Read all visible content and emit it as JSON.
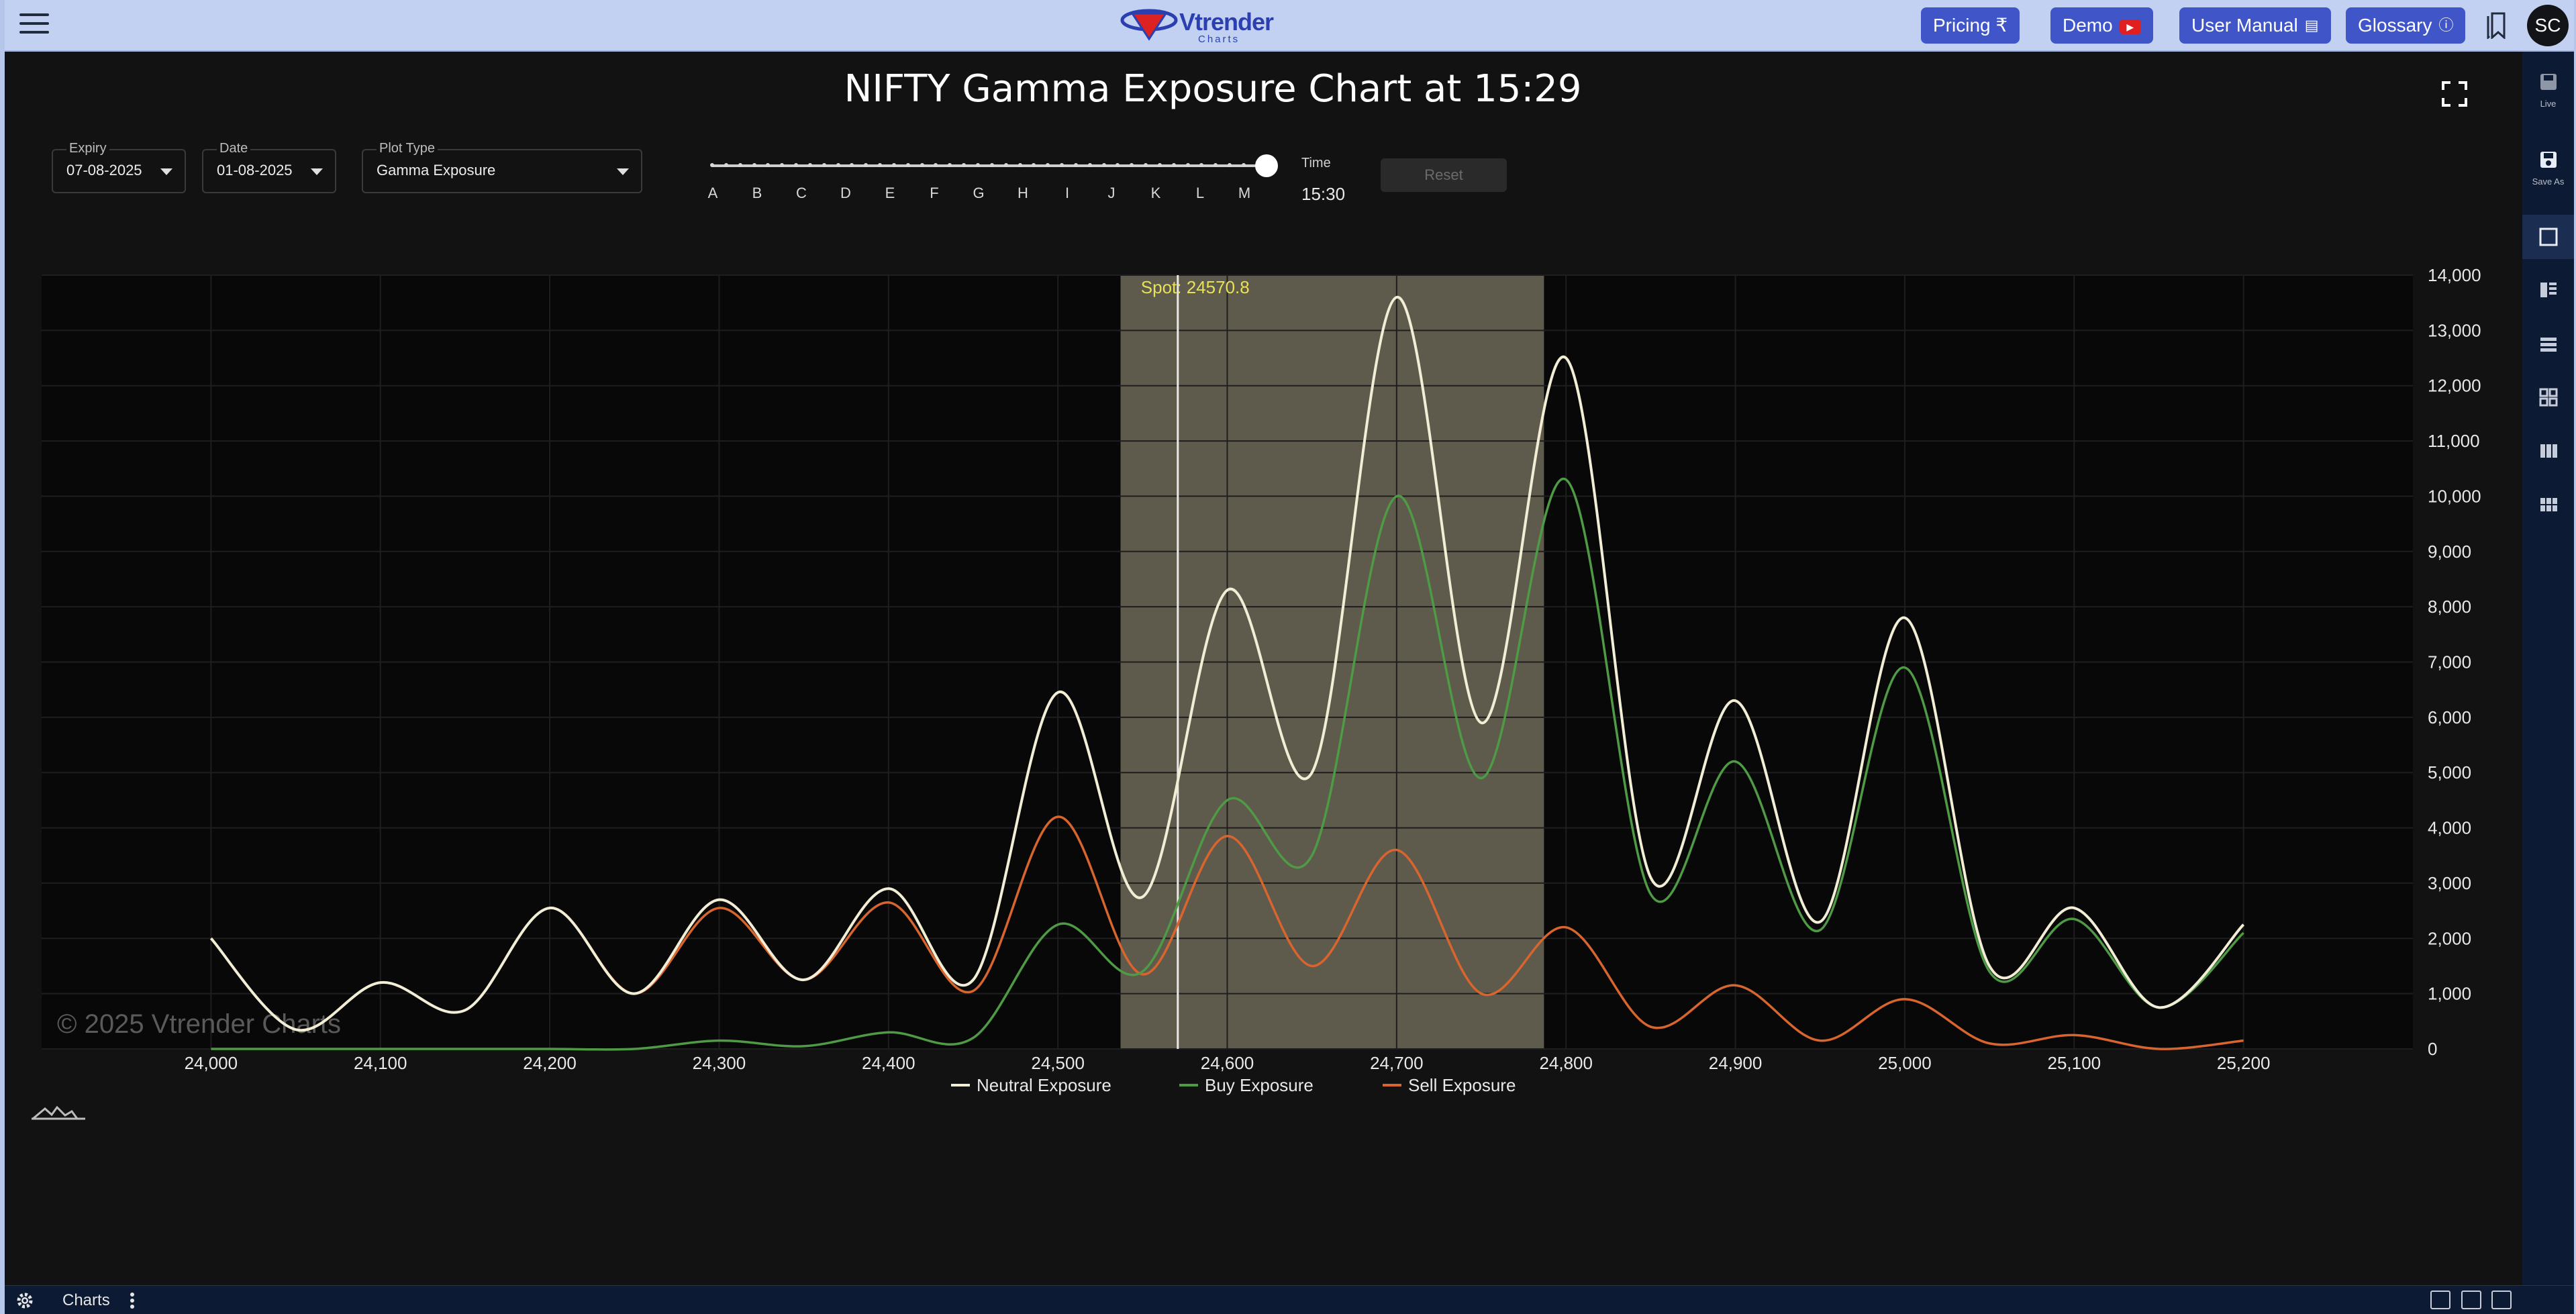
{
  "topbar": {
    "logo_text": "Vtrender",
    "logo_sub": "Charts",
    "pricing_label": "Pricing ₹",
    "demo_label": "Demo",
    "manual_label": "User Manual",
    "glossary_label": "Glossary",
    "avatar_initials": "SC"
  },
  "sidebar": {
    "live_label": "Live",
    "save_label": "Save As"
  },
  "controls": {
    "expiry_label": "Expiry",
    "expiry_value": "07-08-2025",
    "date_label": "Date",
    "date_value": "01-08-2025",
    "plot_type_label": "Plot Type",
    "plot_type_value": "Gamma Exposure",
    "slider_labels": [
      "A",
      "B",
      "C",
      "D",
      "E",
      "F",
      "G",
      "H",
      "I",
      "J",
      "K",
      "L",
      "M"
    ],
    "slider_position": 1.0,
    "time_label": "Time",
    "time_value": "15:30",
    "reset_label": "Reset"
  },
  "bottombar": {
    "tab_label": "Charts"
  },
  "colors": {
    "neutral": "#f2eed6",
    "buy": "#4e9a45",
    "sell": "#d9652e",
    "highlight": "#6e6a58",
    "spot": "#e8e8e8",
    "spot_label": "#e6e05a"
  },
  "chart_data": {
    "type": "line",
    "title": "NIFTY Gamma Exposure Chart at 15:29",
    "watermark": "© 2025 Vtrender Charts",
    "spot_label": "Spot: 24570.8",
    "spot": 24570.8,
    "highlight_range": [
      24537,
      24787
    ],
    "x": [
      24000,
      24050,
      24100,
      24150,
      24200,
      24250,
      24300,
      24350,
      24400,
      24450,
      24500,
      24550,
      24600,
      24650,
      24700,
      24750,
      24800,
      24850,
      24900,
      24950,
      25000,
      25050,
      25100,
      25150,
      25200
    ],
    "xticks": [
      24000,
      24100,
      24200,
      24300,
      24400,
      24500,
      24600,
      24700,
      24800,
      24900,
      25000,
      25100,
      25200
    ],
    "xtick_labels": [
      "24,000",
      "24,100",
      "24,200",
      "24,300",
      "24,400",
      "24,500",
      "24,600",
      "24,700",
      "24,800",
      "24,900",
      "25,000",
      "25,100",
      "25,200"
    ],
    "xlim": [
      23900,
      25300
    ],
    "ylim": [
      0,
      14000
    ],
    "yticks": [
      0,
      1000,
      2000,
      3000,
      4000,
      5000,
      6000,
      7000,
      8000,
      9000,
      10000,
      11000,
      12000,
      13000,
      14000
    ],
    "ytick_labels": [
      "0",
      "1,000",
      "2,000",
      "3,000",
      "4,000",
      "5,000",
      "6,000",
      "7,000",
      "8,000",
      "9,000",
      "10,000",
      "11,000",
      "12,000",
      "13,000",
      "14,000"
    ],
    "grid": true,
    "legend_position": "bottom-center",
    "series": [
      {
        "name": "Neutral Exposure",
        "key": "neutral",
        "values": [
          2000,
          350,
          1200,
          700,
          2550,
          1000,
          2700,
          1250,
          2900,
          1250,
          6450,
          2750,
          8300,
          5000,
          13600,
          5900,
          12500,
          3100,
          6300,
          2300,
          7800,
          1500,
          2550,
          750,
          2250
        ]
      },
      {
        "name": "Buy Exposure",
        "key": "buy",
        "values": [
          0,
          0,
          0,
          0,
          0,
          0,
          150,
          50,
          300,
          200,
          2250,
          1400,
          4500,
          3500,
          10000,
          4900,
          10300,
          2800,
          5200,
          2150,
          6900,
          1400,
          2350,
          750,
          2100
        ]
      },
      {
        "name": "Sell Exposure",
        "key": "sell",
        "values": [
          2000,
          350,
          1200,
          700,
          2550,
          1000,
          2550,
          1250,
          2650,
          1050,
          4200,
          1350,
          3850,
          1500,
          3600,
          1000,
          2200,
          400,
          1150,
          150,
          900,
          100,
          250,
          0,
          150
        ]
      }
    ]
  }
}
